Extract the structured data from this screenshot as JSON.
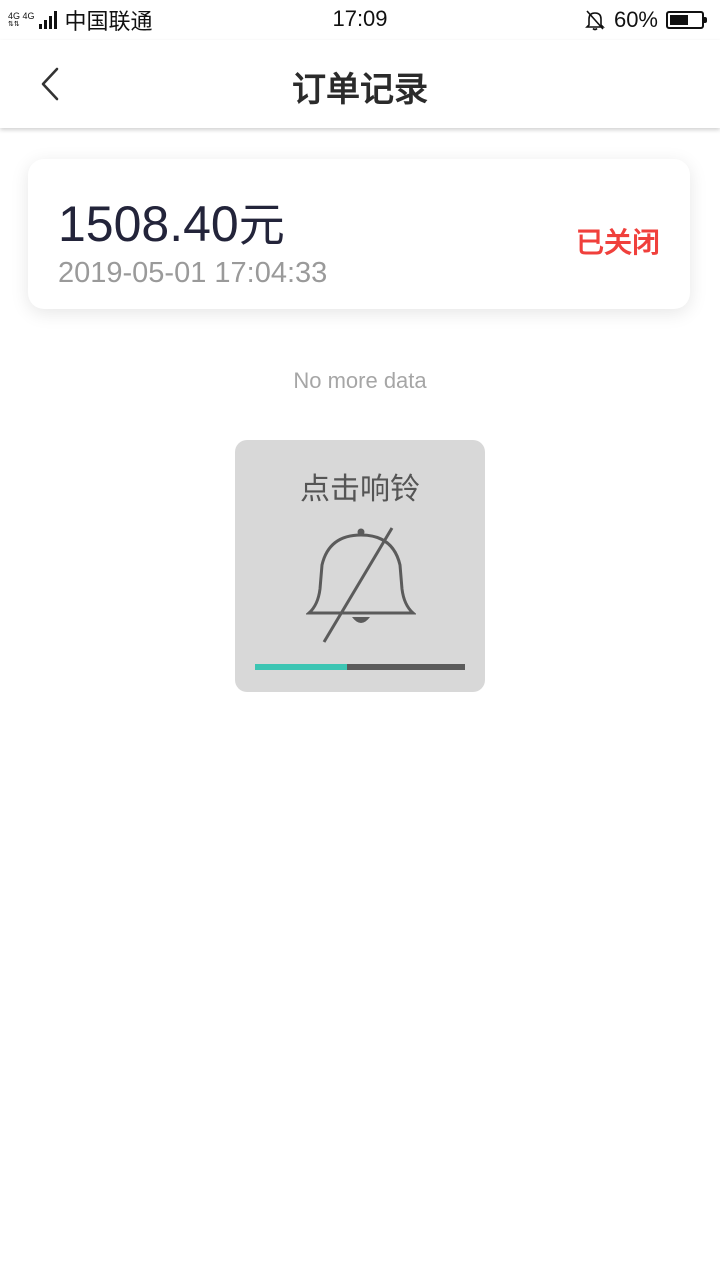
{
  "status_bar": {
    "network_label": "4G 4G",
    "carrier": "中国联通",
    "time": "17:09",
    "battery_percent": "60%",
    "battery_level": 0.6,
    "mute_icon": "bell-off-icon"
  },
  "nav": {
    "back_icon": "chevron-left-icon",
    "title": "订单记录"
  },
  "orders": [
    {
      "amount": "1508.40",
      "unit": "元",
      "time": "2019-05-01 17:04:33",
      "status": "已关闭",
      "status_color": "#f0403c"
    }
  ],
  "list_footer": "No more data",
  "bell_panel": {
    "label": "点击响铃",
    "icon": "bell-off-icon",
    "progress": 0.44,
    "progress_color": "#3cc5b3"
  }
}
